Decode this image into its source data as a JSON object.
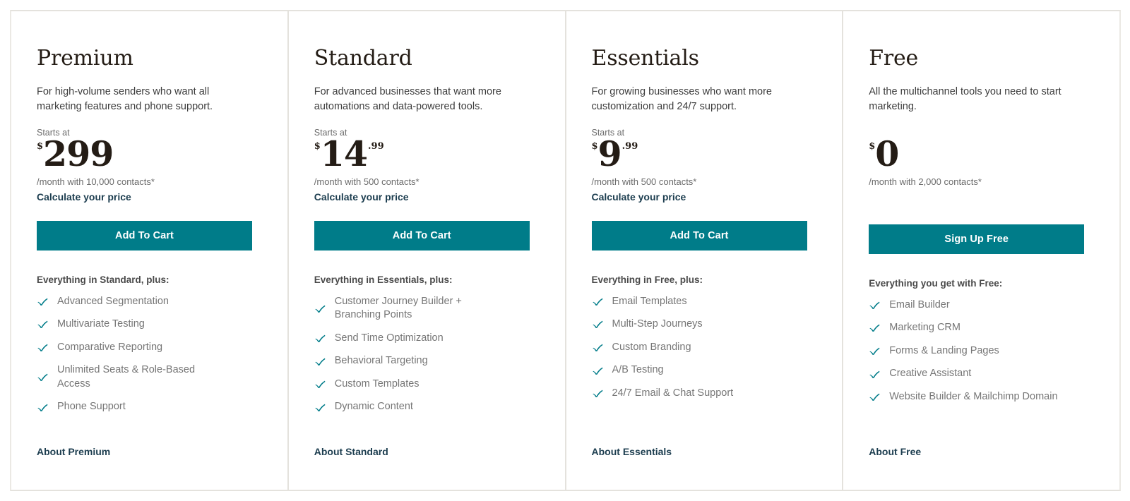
{
  "theme": {
    "button_color": "#007C89",
    "link_color": "#1C3D4F",
    "check_color": "#007C89",
    "price_color": "#241C15",
    "feature_text_color": "#767676",
    "divider_color": "#E4E2DD"
  },
  "plans": [
    {
      "name": "Premium",
      "description": "For high-volume senders who want all marketing features and phone support.",
      "starts_at_label": "Starts at",
      "currency": "$",
      "amount": "299",
      "cents": "",
      "per_month": "/month with 10,000 contacts*",
      "calculate_link": "Calculate your price",
      "cta_label": "Add To Cart",
      "features_heading": "Everything in Standard, plus:",
      "features": [
        "Advanced Segmentation",
        "Multivariate Testing",
        "Comparative Reporting",
        "Unlimited Seats & Role-Based Access",
        "Phone Support"
      ],
      "about_link": "About Premium"
    },
    {
      "name": "Standard",
      "description": "For advanced businesses that want more automations and data-powered tools.",
      "starts_at_label": "Starts at",
      "currency": "$",
      "amount": "14",
      "cents": ".99",
      "per_month": "/month with 500 contacts*",
      "calculate_link": "Calculate your price",
      "cta_label": "Add To Cart",
      "features_heading": "Everything in Essentials, plus:",
      "features": [
        "Customer Journey Builder + Branching Points",
        "Send Time Optimization",
        "Behavioral Targeting",
        "Custom Templates",
        "Dynamic Content"
      ],
      "about_link": "About Standard"
    },
    {
      "name": "Essentials",
      "description": "For growing businesses who want more customization and 24/7 support.",
      "starts_at_label": "Starts at",
      "currency": "$",
      "amount": "9",
      "cents": ".99",
      "per_month": "/month with 500 contacts*",
      "calculate_link": "Calculate your price",
      "cta_label": "Add To Cart",
      "features_heading": "Everything in Free, plus:",
      "features": [
        "Email Templates",
        "Multi-Step Journeys",
        "Custom Branding",
        "A/B Testing",
        "24/7 Email & Chat Support"
      ],
      "about_link": "About Essentials"
    },
    {
      "name": "Free",
      "description": "All the multichannel tools you need to start marketing.",
      "starts_at_label": "",
      "currency": "$",
      "amount": "0",
      "cents": "",
      "per_month": "/month with 2,000 contacts*",
      "calculate_link": "",
      "cta_label": "Sign Up Free",
      "features_heading": "Everything you get with Free:",
      "features": [
        "Email Builder",
        "Marketing CRM",
        "Forms & Landing Pages",
        "Creative Assistant",
        "Website Builder & Mailchimp Domain"
      ],
      "about_link": "About Free"
    }
  ]
}
